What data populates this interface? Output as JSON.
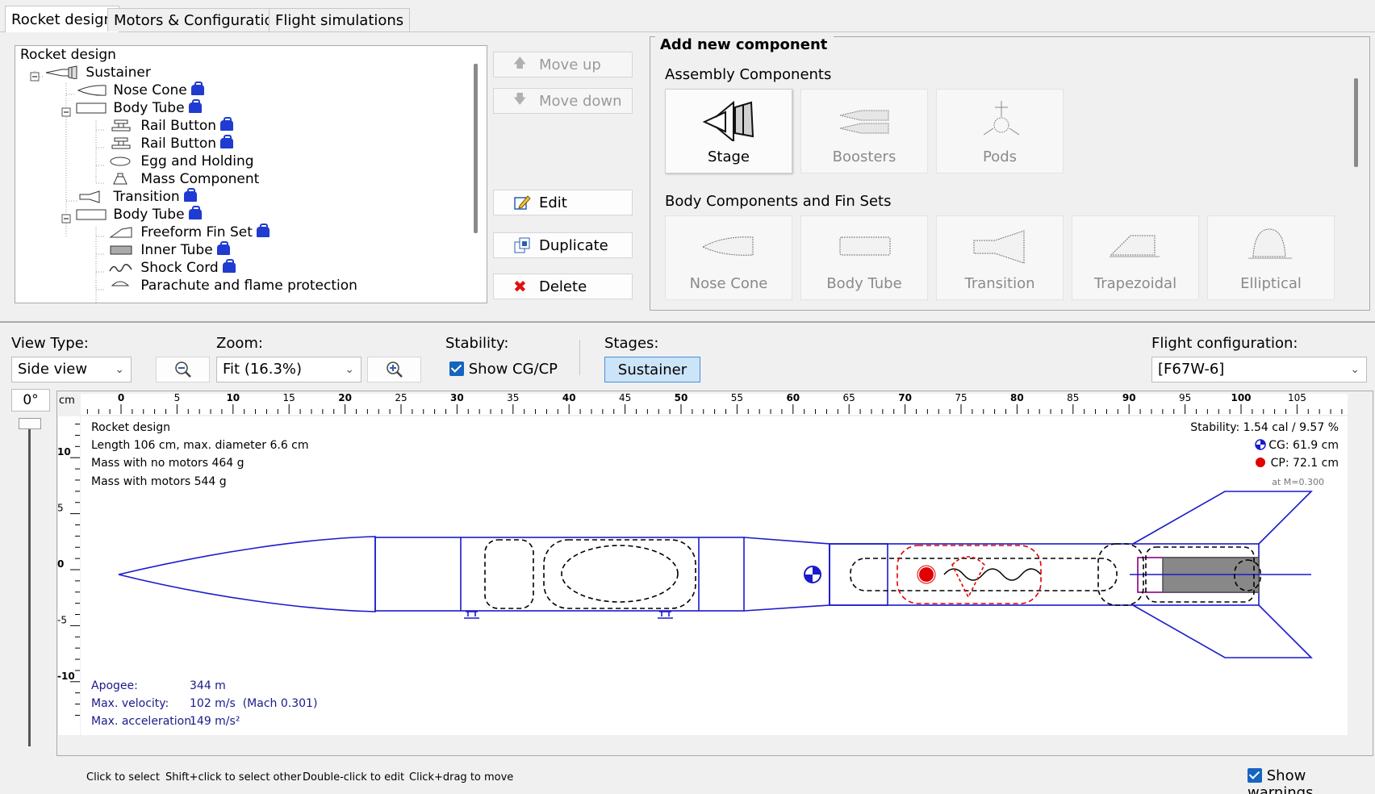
{
  "tabs": [
    {
      "label": "Rocket design",
      "active": true
    },
    {
      "label": "Motors & Configuration"
    },
    {
      "label": "Flight simulations"
    }
  ],
  "tree": {
    "root": "Rocket design",
    "items": [
      {
        "label": "Sustainer",
        "icon": "stage-icon"
      },
      {
        "label": "Nose Cone",
        "icon": "nose-cone-icon"
      },
      {
        "label": "Body Tube",
        "icon": "body-tube-icon"
      },
      {
        "label": "Rail Button",
        "icon": "rail-button-icon"
      },
      {
        "label": "Rail Button",
        "icon": "rail-button-icon"
      },
      {
        "label": "Egg and Holding",
        "icon": "mass-object-icon"
      },
      {
        "label": "Mass Component",
        "icon": "mass-component-icon"
      },
      {
        "label": "Transition",
        "icon": "transition-icon"
      },
      {
        "label": "Body Tube",
        "icon": "body-tube-icon"
      },
      {
        "label": "Freeform Fin Set",
        "icon": "freeform-fin-icon"
      },
      {
        "label": "Inner Tube",
        "icon": "inner-tube-icon"
      },
      {
        "label": "Shock Cord",
        "icon": "shock-cord-icon"
      },
      {
        "label": "Parachute and flame protection",
        "icon": "parachute-icon"
      }
    ]
  },
  "actions": {
    "move_up": "Move up",
    "move_down": "Move down",
    "edit": "Edit",
    "duplicate": "Duplicate",
    "delete": "Delete"
  },
  "add_component": {
    "title": "Add new component",
    "assembly_title": "Assembly Components",
    "assembly": [
      "Stage",
      "Boosters",
      "Pods"
    ],
    "body_title": "Body Components and Fin Sets",
    "body": [
      "Nose Cone",
      "Body Tube",
      "Transition",
      "Trapezoidal",
      "Elliptical"
    ]
  },
  "controls": {
    "view_type_label": "View Type:",
    "view_type": "Side view",
    "zoom_label": "Zoom:",
    "zoom": "Fit (16.3%)",
    "stability_label": "Stability:",
    "show_cgcp": "Show CG/CP",
    "stages_label": "Stages:",
    "stage": "Sustainer",
    "flight_config_label": "Flight configuration:",
    "flight_config": "[F67W-6]"
  },
  "rotation": "0°",
  "ruler": {
    "unit": "cm",
    "ticks": [
      "0",
      "5",
      "10",
      "15",
      "20",
      "25",
      "30",
      "35",
      "40",
      "45",
      "50",
      "55",
      "60",
      "65",
      "70",
      "75",
      "80",
      "85",
      "90",
      "95",
      "100",
      "105"
    ]
  },
  "vruler": {
    "ticks": [
      "10",
      "5",
      "0",
      "-5",
      "-10"
    ]
  },
  "info": {
    "name": "Rocket design",
    "length": "Length 106 cm, max. diameter 6.6 cm",
    "mass_no_motors": "Mass with no motors 464 g",
    "mass_with_motors": "Mass with motors 544 g",
    "stability": "Stability: 1.54 cal / 9.57 %",
    "cg": "CG: 61.9 cm",
    "cp": "CP: 72.1 cm",
    "mach": "at M=0.300",
    "apogee_label": "Apogee:",
    "apogee": "344 m",
    "vel_label": "Max. velocity:",
    "vel": "102 m/s  (Mach 0.301)",
    "acc_label": "Max. acceleration:",
    "acc": "149 m/s²"
  },
  "hints": [
    "Click to select",
    "Shift+click to select other",
    "Double-click to edit",
    "Click+drag to move"
  ],
  "show_warnings": "Show warnings",
  "colors": {
    "accent": "#1565c0",
    "rocket": "#1a1acc",
    "cp": "#e00000"
  }
}
